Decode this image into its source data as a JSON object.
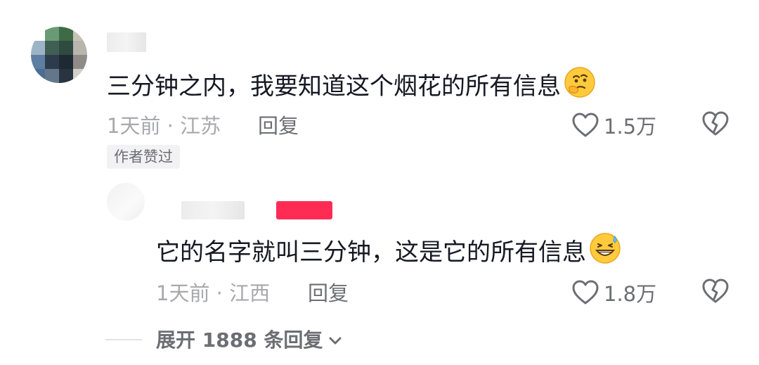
{
  "comment": {
    "text": "三分钟之内，我要知道这个烟花的所有信息",
    "emoji": "thinking-face-emoji",
    "time": "1天前",
    "location": "江苏",
    "reply_label": "回复",
    "likes": "1.5万",
    "badge": "作者赞过"
  },
  "reply": {
    "text": "它的名字就叫三分钟，这是它的所有信息",
    "emoji": "grinning-sweat-emoji",
    "time": "1天前",
    "location": "江西",
    "reply_label": "回复",
    "likes": "1.8万"
  },
  "expand": {
    "label": "展开 1888 条回复"
  },
  "colors": {
    "text_primary": "#161823",
    "text_secondary": "#a8a9ad",
    "text_tertiary": "#6d6e74",
    "author_tag": "#fe2c55"
  }
}
